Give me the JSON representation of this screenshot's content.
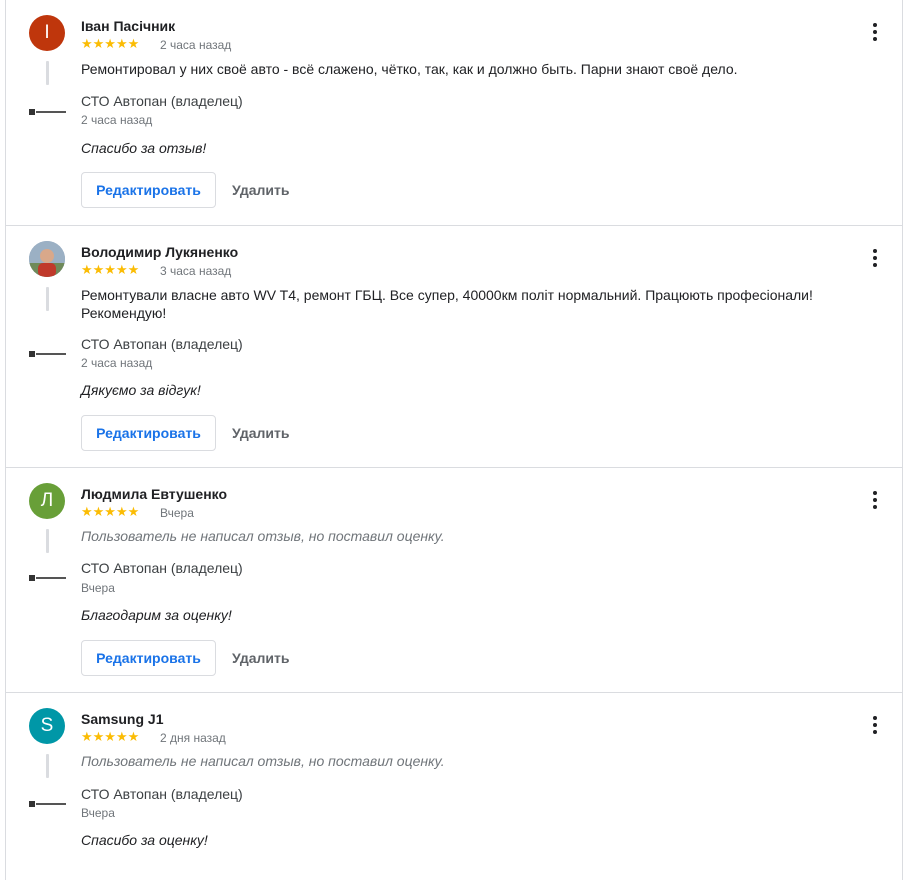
{
  "reviews": [
    {
      "author": "Іван Пасічник",
      "avatar_letter": "I",
      "avatar_color": "#bf360c",
      "rating": 5,
      "stars": "★★★★★",
      "date": "2 часа назад",
      "text": "Ремонтировал у них своё авто - всё слажено, чётко, так, как и должно быть. Парни знают своё дело.",
      "owner": "СТО Автопан (владелец)",
      "reply_date": "2 часа назад",
      "reply": "Спасибо за отзыв!",
      "edit_label": "Редактировать",
      "delete_label": "Удалить"
    },
    {
      "author": "Володимир Лукяненко",
      "avatar_letter": "",
      "avatar_color": "#8aa0b8",
      "rating": 5,
      "stars": "★★★★★",
      "date": "3 часа назад",
      "text": "Ремонтували власне авто WV T4, ремонт ГБЦ. Все супер, 40000км політ нормальний. Працюють професіонали! Рекомендую!",
      "owner": "СТО Автопан (владелец)",
      "reply_date": "2 часа назад",
      "reply": "Дякуємо за відгук!",
      "edit_label": "Редактировать",
      "delete_label": "Удалить"
    },
    {
      "author": "Людмила Евтушенко",
      "avatar_letter": "Л",
      "avatar_color": "#689f38",
      "rating": 5,
      "stars": "★★★★★",
      "date": "Вчера",
      "text": "Пользователь не написал отзыв, но поставил оценку.",
      "owner": "СТО Автопан (владелец)",
      "reply_date": "Вчера",
      "reply": "Благодарим за оценку!",
      "edit_label": "Редактировать",
      "delete_label": "Удалить"
    },
    {
      "author": "Samsung J1",
      "avatar_letter": "S",
      "avatar_color": "#0097a7",
      "rating": 5,
      "stars": "★★★★★",
      "date": "2 дня назад",
      "text": "Пользователь не написал отзыв, но поставил оценку.",
      "owner": "СТО Автопан (владелец)",
      "reply_date": "Вчера",
      "reply": "Спасибо за оценку!"
    }
  ],
  "icons": {
    "menu": "more-vert-icon",
    "owner_logo": "business-logo-icon"
  }
}
